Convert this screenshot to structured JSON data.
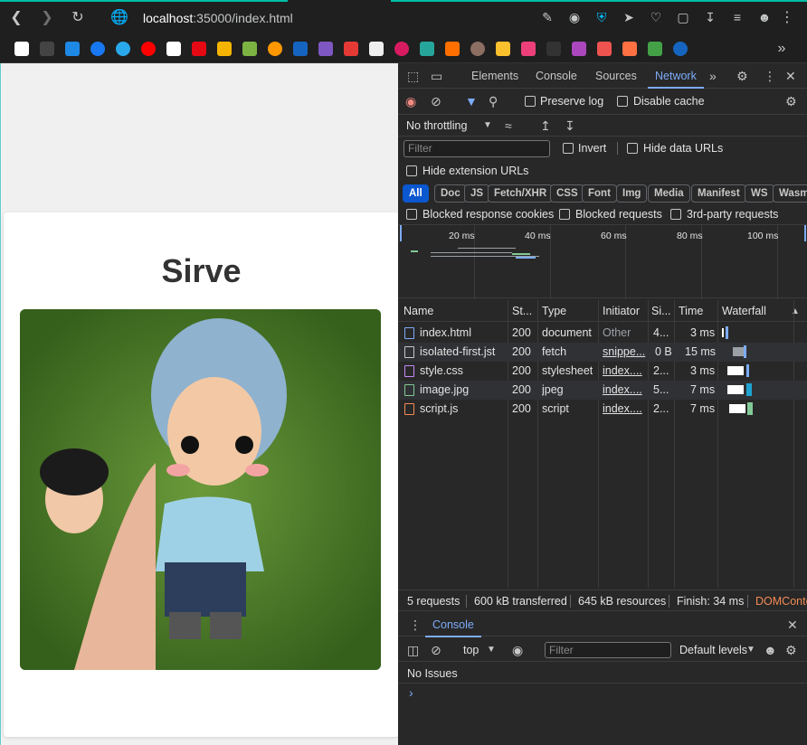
{
  "browser": {
    "url_host": "localhost",
    "url_rest": ":35000/index.html"
  },
  "page": {
    "heading": "Sirve"
  },
  "devtools": {
    "tabs": [
      "Elements",
      "Console",
      "Sources",
      "Network"
    ],
    "active_tab": "Network",
    "preserve_log": "Preserve log",
    "disable_cache": "Disable cache",
    "throttling": "No throttling",
    "filter_placeholder": "Filter",
    "invert": "Invert",
    "hide_data_urls": "Hide data URLs",
    "hide_extension_urls": "Hide extension URLs",
    "type_filters": [
      "All",
      "Doc",
      "JS",
      "Fetch/XHR",
      "CSS",
      "Font",
      "Img",
      "Media",
      "Manifest",
      "WS",
      "Wasm"
    ],
    "blocked_response_cookies": "Blocked response cookies",
    "blocked_requests": "Blocked requests",
    "third_party_requests": "3rd-party requests",
    "timeline_labels": [
      "20 ms",
      "40 ms",
      "60 ms",
      "80 ms",
      "100 ms"
    ],
    "columns": {
      "name": "Name",
      "status": "St...",
      "type": "Type",
      "initiator": "Initiator",
      "size": "Si...",
      "time": "Time",
      "waterfall": "Waterfall"
    },
    "requests": [
      {
        "name": "index.html",
        "status": "200",
        "type": "document",
        "initiator": "Other",
        "size": "4...",
        "time": "3 ms",
        "icon_color": "#7cacf8"
      },
      {
        "name": "isolated-first.jst",
        "status": "200",
        "type": "fetch",
        "initiator": "snippe...",
        "size": "0 B",
        "time": "15 ms",
        "icon_color": "#c7c7c7"
      },
      {
        "name": "style.css",
        "status": "200",
        "type": "stylesheet",
        "initiator": "index....",
        "size": "2...",
        "time": "3 ms",
        "icon_color": "#c58af9"
      },
      {
        "name": "image.jpg",
        "status": "200",
        "type": "jpeg",
        "initiator": "index....",
        "size": "5...",
        "time": "7 ms",
        "icon_color": "#81c995"
      },
      {
        "name": "script.js",
        "status": "200",
        "type": "script",
        "initiator": "index....",
        "size": "2...",
        "time": "7 ms",
        "icon_color": "#f28b54"
      }
    ],
    "summary": {
      "requests": "5 requests",
      "transferred": "600 kB transferred",
      "resources": "645 kB resources",
      "finish": "Finish: 34 ms",
      "domcontent": "DOMConte"
    },
    "console": {
      "tab": "Console",
      "context": "top",
      "filter_placeholder": "Filter",
      "levels": "Default levels",
      "no_issues": "No Issues"
    }
  }
}
